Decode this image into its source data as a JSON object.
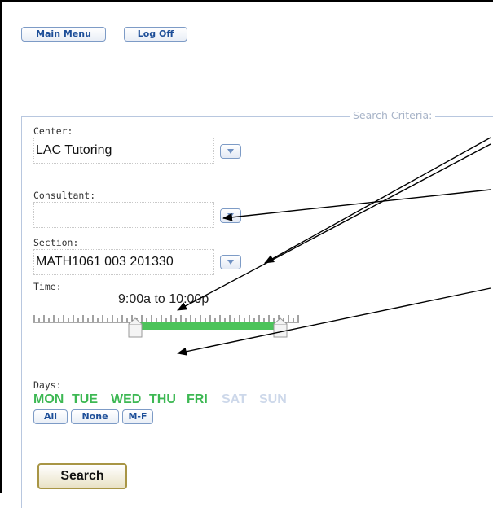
{
  "toolbar": {
    "main_menu": "Main Menu",
    "log_off": "Log Off"
  },
  "search_criteria": {
    "legend": "Search Criteria:",
    "center": {
      "label": "Center:",
      "value": "LAC Tutoring"
    },
    "consultant": {
      "label": "Consultant:",
      "value": ""
    },
    "section": {
      "label": "Section:",
      "value": "MATH1061 003 201330"
    },
    "time": {
      "label": "Time:",
      "range": "9:00a to 10:00p",
      "start": "9:00a",
      "end": "10:00p"
    },
    "days": {
      "label": "Days:",
      "items": [
        {
          "name": "MON",
          "selected": true
        },
        {
          "name": "TUE",
          "selected": true
        },
        {
          "name": "WED",
          "selected": true
        },
        {
          "name": "THU",
          "selected": true
        },
        {
          "name": "FRI",
          "selected": true
        },
        {
          "name": "SAT",
          "selected": false
        },
        {
          "name": "SUN",
          "selected": false
        }
      ],
      "buttons": {
        "all": "All",
        "none": "None",
        "mf": "M-F"
      }
    },
    "search_button": "Search"
  },
  "colors": {
    "selected_day": "#3db853",
    "unselected_day": "#cdd8ea",
    "slider_range": "#4cc35a",
    "button_text": "#1d4e98"
  }
}
